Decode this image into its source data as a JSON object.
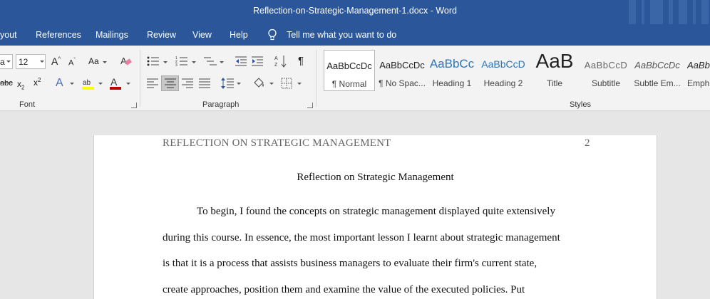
{
  "window": {
    "title": "Reflection-on-Strategic-Management-1.docx  -  Word"
  },
  "menu": {
    "items": [
      "yout",
      "References",
      "Mailings",
      "Review",
      "View",
      "Help"
    ],
    "tell_me": "Tell me what you want to do"
  },
  "ribbon": {
    "font": {
      "font_name": "a",
      "font_size": "12",
      "label": "Font",
      "change_case": "Aa"
    },
    "paragraph": {
      "label": "Paragraph"
    },
    "styles": {
      "label": "Styles",
      "items": [
        {
          "preview": "AaBbCcDc",
          "name": "¶ Normal"
        },
        {
          "preview": "AaBbCcDc",
          "name": "¶ No Spac..."
        },
        {
          "preview": "AaBbCc",
          "name": "Heading 1"
        },
        {
          "preview": "AaBbCcD",
          "name": "Heading 2"
        },
        {
          "preview": "AaB",
          "name": "Title"
        },
        {
          "preview": "AaBbCcD",
          "name": "Subtitle"
        },
        {
          "preview": "AaBbCcDc",
          "name": "Subtle Em..."
        },
        {
          "preview": "AaBb",
          "name": "Emph"
        }
      ]
    }
  },
  "document": {
    "header_text": "REFLECTION ON STRATEGIC MANAGEMENT",
    "page_number": "2",
    "title": "Reflection on Strategic Management",
    "lines": [
      "To begin, I found the concepts on strategic management displayed quite extensively",
      "during this course. In essence, the most important lesson I learnt about strategic management",
      "is that it is a process that assists business managers to evaluate their firm's current state,",
      "create approaches, position them and examine the value of the executed policies. Put"
    ]
  },
  "colors": {
    "word_blue": "#2b579a",
    "ribbon_bg": "#f3f3f3",
    "canvas_bg": "#e6e6e6",
    "highlight_yellow": "#ffff00",
    "font_color_red": "#c00000"
  }
}
